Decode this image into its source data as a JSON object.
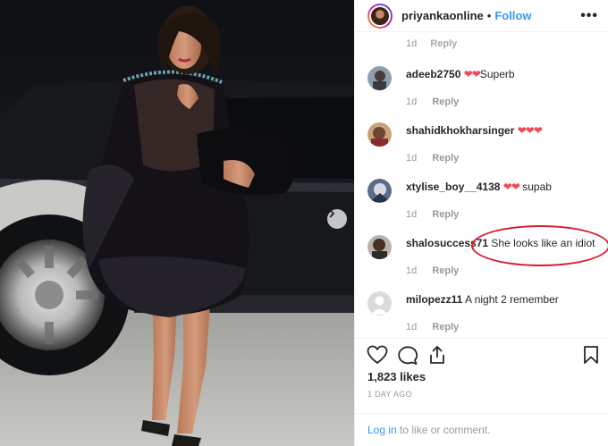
{
  "post": {
    "username": "priyankaonline",
    "separator": "•",
    "follow_label": "Follow",
    "more_label": "•••"
  },
  "icons": {
    "more": "more-options-icon",
    "like": "heart-icon",
    "comment": "comment-icon",
    "share": "share-icon",
    "save": "bookmark-icon",
    "next": "chevron-right-icon"
  },
  "partial_comment": {
    "time": "1d",
    "reply_label": "Reply"
  },
  "comments": [
    {
      "username": "adeeb2750",
      "hearts": "❤❤",
      "text": "Superb",
      "time": "1d",
      "reply_label": "Reply"
    },
    {
      "username": "shahidkhokharsinger",
      "hearts": "❤❤❤",
      "text": "",
      "time": "1d",
      "reply_label": "Reply"
    },
    {
      "username": "xtylise_boy__4138",
      "hearts": "❤❤",
      "text": "supab",
      "time": "1d",
      "reply_label": "Reply"
    },
    {
      "username": "shalosuccess71",
      "hearts": "",
      "text": "She looks like an idiot",
      "time": "1d",
      "reply_label": "Reply"
    },
    {
      "username": "milopezz11",
      "hearts": "",
      "text": "A night 2 remember",
      "time": "1d",
      "reply_label": "Reply"
    }
  ],
  "stats": {
    "likes": "1,823 likes",
    "time_ago": "1 DAY AGO"
  },
  "footer": {
    "login_label": "Log in",
    "rest": " to like or comment."
  },
  "colors": {
    "link": "#3897f0",
    "heart": "#ed4956",
    "highlight": "#d8192a"
  }
}
